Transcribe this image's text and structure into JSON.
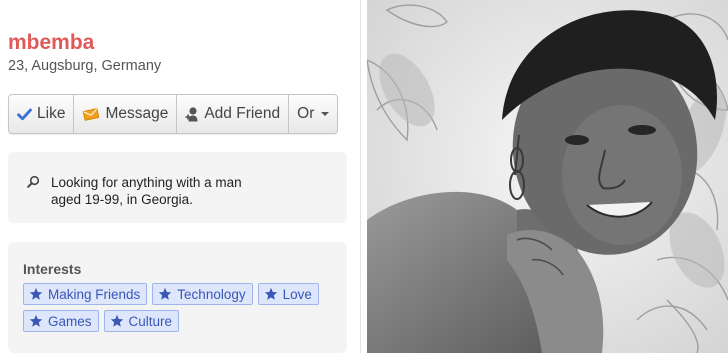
{
  "profile": {
    "name": "mbemba",
    "meta": "23, Augsburg, Germany"
  },
  "actions": {
    "like": "Like",
    "message": "Message",
    "add_friend": "Add Friend",
    "or": "Or"
  },
  "looking_for": {
    "icon": "search-icon",
    "line1": "Looking for anything with a man",
    "line2": "aged 19-99, in Georgia."
  },
  "interests": {
    "heading": "Interests",
    "tags": [
      "Making Friends",
      "Technology",
      "Love",
      "Games",
      "Culture"
    ]
  },
  "colors": {
    "name": "#e05a5a",
    "tag_bg": "#dde6fb",
    "tag_border": "#9fb4ea",
    "tag_text": "#3a57b8",
    "check": "#3b6fd8",
    "message": "#f0a020"
  }
}
